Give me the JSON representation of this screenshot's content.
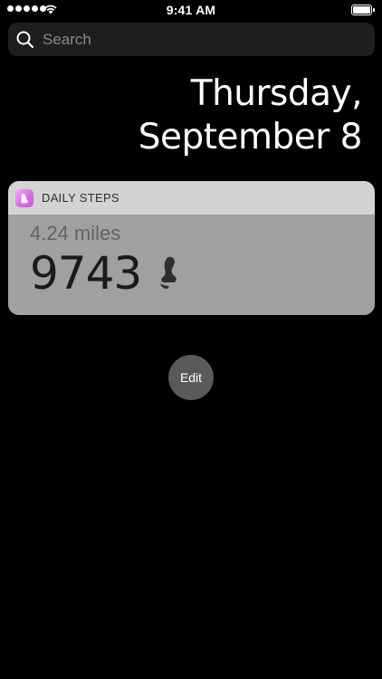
{
  "status_bar": {
    "time": "9:41 AM",
    "signal_bars": 5,
    "battery_level": 1.0
  },
  "search": {
    "placeholder": "Search",
    "value": ""
  },
  "date": {
    "weekday": "Thursday,",
    "month_day": "September 8"
  },
  "widget": {
    "app_icon": "foot-icon",
    "title": "DAILY STEPS",
    "distance": "4.24 miles",
    "steps": "9743",
    "step_icon": "foot-icon",
    "colors": {
      "header_bg": "#d3d3d3",
      "body_bg": "#a0a0a0",
      "icon_gradient": [
        "#f4a8f6",
        "#c25ad0"
      ]
    }
  },
  "edit_button": {
    "label": "Edit"
  }
}
